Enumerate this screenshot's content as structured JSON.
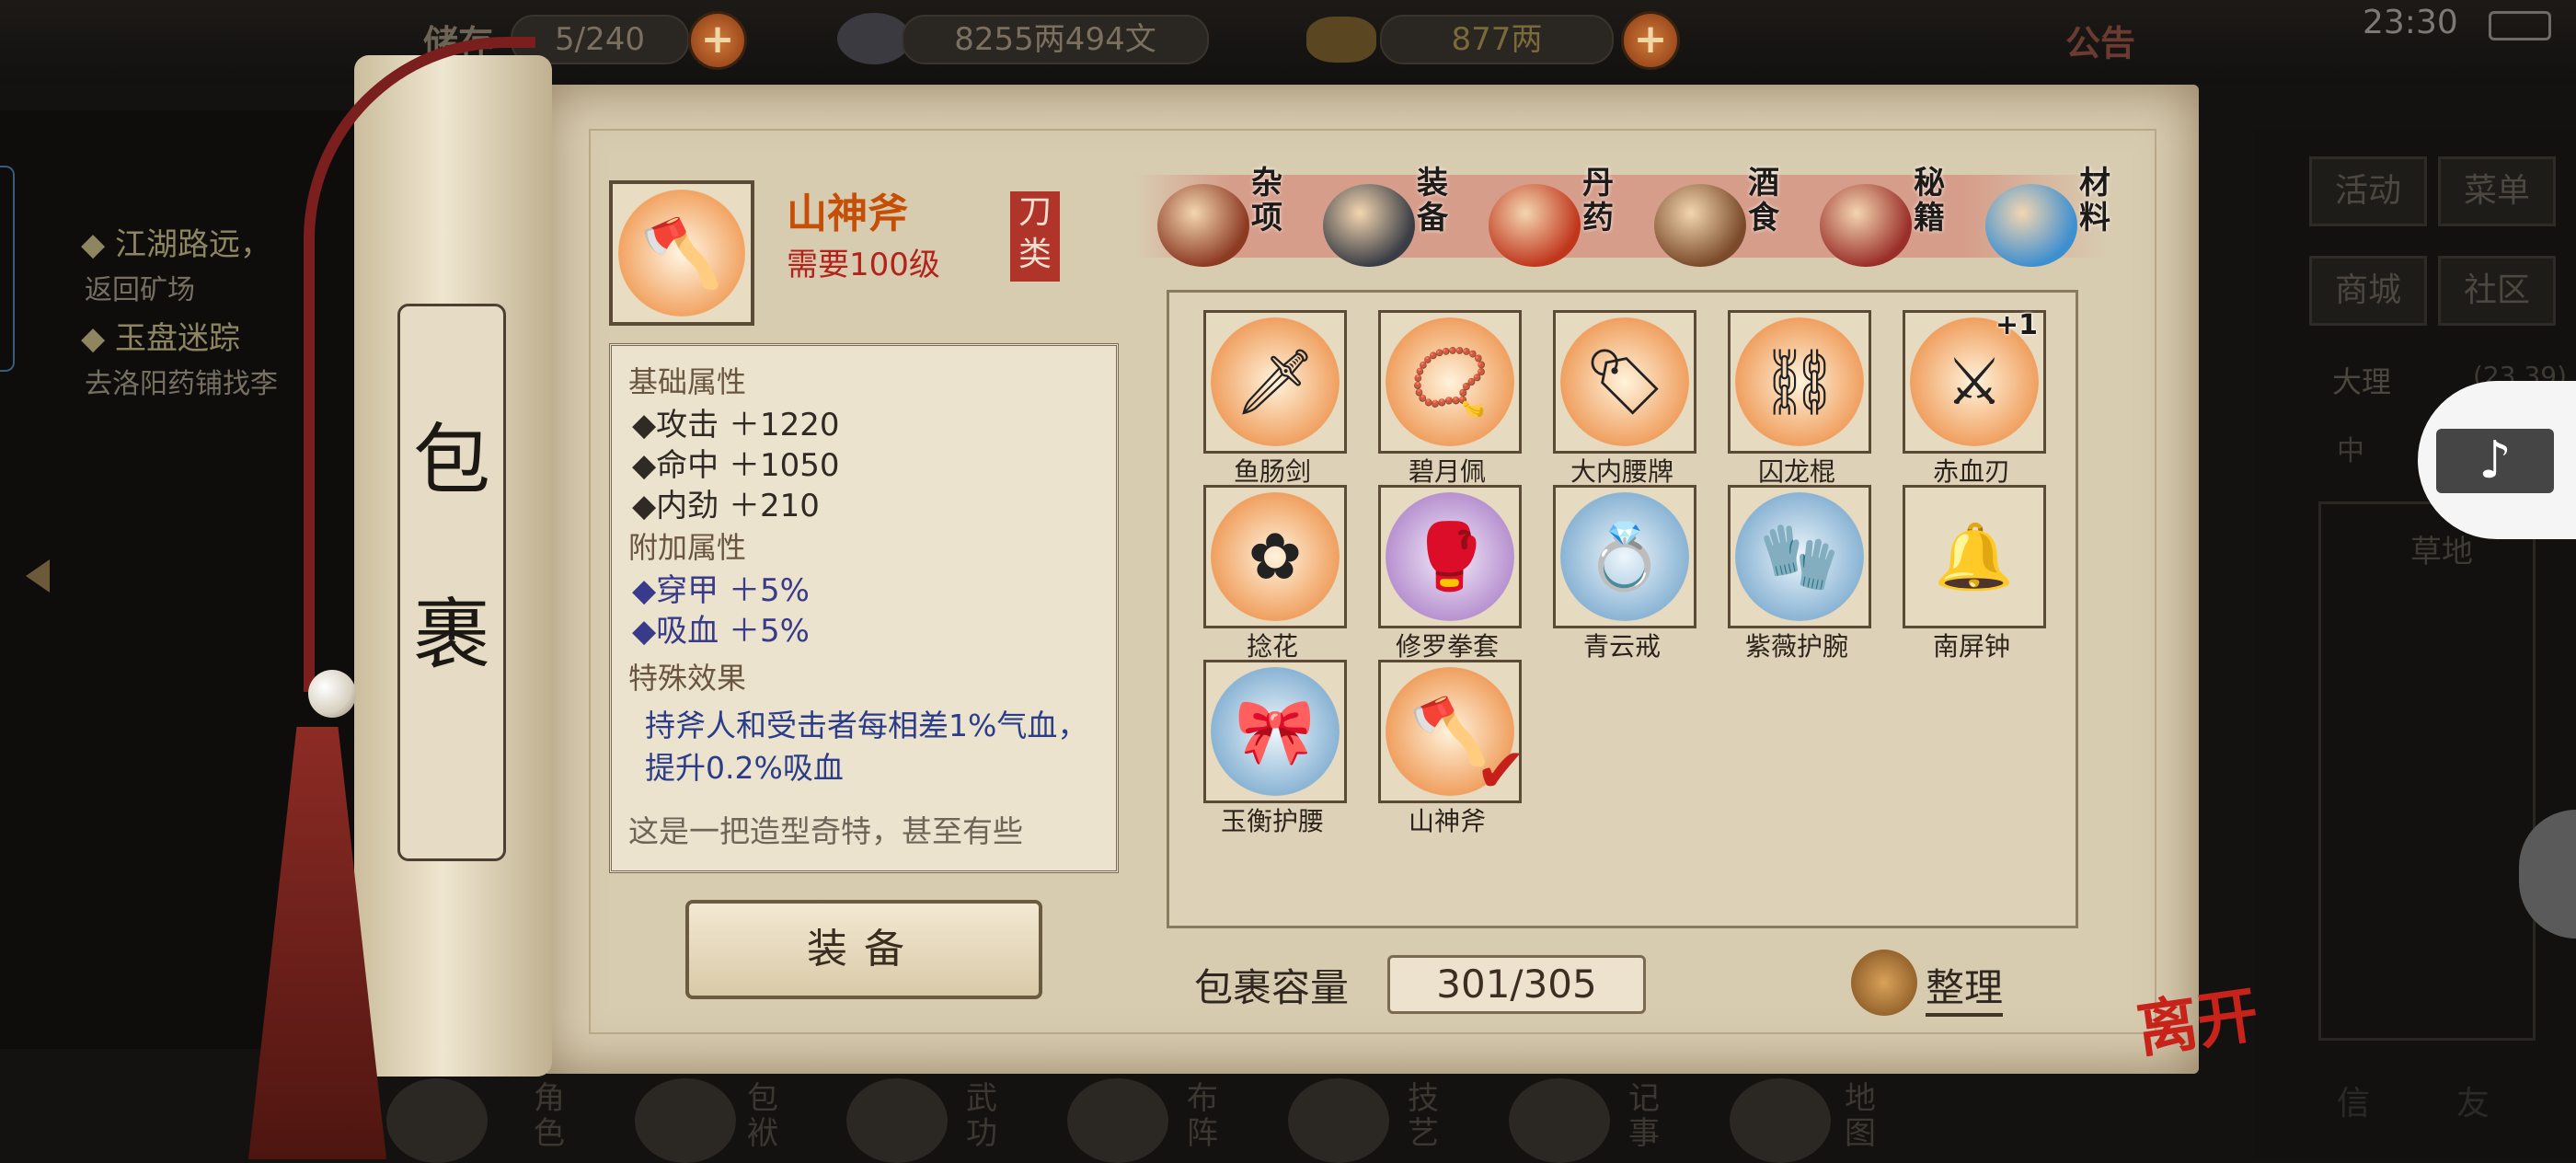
{
  "hud": {
    "bag_label": "储存",
    "bag_count": "5/240",
    "silver": "8255两494文",
    "gold": "877两",
    "plus": "+",
    "notice": "公告",
    "time": "23:30"
  },
  "quests": [
    {
      "title": "◆ 江湖路远，",
      "sub": "返回矿场"
    },
    {
      "title": "◆ 玉盘迷踪",
      "sub": "去洛阳药铺找李"
    }
  ],
  "right_panel": {
    "buttons": [
      "活动",
      "菜单",
      "商城",
      "社区"
    ],
    "location": "大理",
    "coords": "(23,39)",
    "channel": "中",
    "area": "草地",
    "bottom": [
      "信",
      "友"
    ]
  },
  "scroll_title": [
    "包",
    "裹"
  ],
  "selected": {
    "name": "山神斧",
    "requirement": "需要100级",
    "type": "刀类",
    "stats": {
      "base_header": "基础属性",
      "base": [
        "◆攻击 ＋1220",
        "◆命中 ＋1050",
        "◆内劲 ＋210"
      ],
      "extra_header": "附加属性",
      "extra": [
        "◆穿甲 ＋5%",
        "◆吸血 ＋5%"
      ],
      "special_header": "特殊效果",
      "special": "持斧人和受击者每相差1%气血，提升0.2%吸血",
      "description": "这是一把造型奇特，甚至有些"
    },
    "equip_button": "装备"
  },
  "tabs": [
    {
      "label": "杂项",
      "icon": "jar-icon",
      "color": "#8c3a22"
    },
    {
      "label": "装备",
      "icon": "armor-icon",
      "color": "#3a3d45",
      "active": true
    },
    {
      "label": "丹药",
      "icon": "pill-icon",
      "color": "#c0361c"
    },
    {
      "label": "酒食",
      "icon": "food-icon",
      "color": "#7a4a2a"
    },
    {
      "label": "秘籍",
      "icon": "book-icon",
      "color": "#9a2f2a"
    },
    {
      "label": "材料",
      "icon": "crystal-icon",
      "color": "#3d8fd0"
    }
  ],
  "items": [
    {
      "name": "鱼肠剑",
      "icon": "sword-icon",
      "glyph": "🗡",
      "glow": "orange"
    },
    {
      "name": "碧月佩",
      "icon": "pendant-icon",
      "glyph": "📿",
      "glow": "orange"
    },
    {
      "name": "大内腰牌",
      "icon": "token-icon",
      "glyph": "🏷",
      "glow": "orange"
    },
    {
      "name": "囚龙棍",
      "icon": "staff-icon",
      "glyph": "⛓",
      "glow": "orange"
    },
    {
      "name": "赤血刃",
      "icon": "blade-icon",
      "glyph": "⚔",
      "glow": "orange",
      "badge": "+1"
    },
    {
      "name": "捻花",
      "icon": "flower-icon",
      "glyph": "✿",
      "glow": "orange"
    },
    {
      "name": "修罗拳套",
      "icon": "gauntlet-icon",
      "glyph": "🥊",
      "glow": "purple"
    },
    {
      "name": "青云戒",
      "icon": "ring-icon",
      "glyph": "💍",
      "glow": "blue"
    },
    {
      "name": "紫薇护腕",
      "icon": "bracer-icon",
      "glyph": "🧤",
      "glow": "blue"
    },
    {
      "name": "南屏钟",
      "icon": "bell-icon",
      "glyph": "🔔",
      "glow": "none"
    },
    {
      "name": "玉衡护腰",
      "icon": "belt-icon",
      "glyph": "🎀",
      "glow": "blue"
    },
    {
      "name": "山神斧",
      "icon": "axe-icon",
      "glyph": "🪓",
      "glow": "orange",
      "equipped": true
    }
  ],
  "footer": {
    "capacity_label": "包裹容量",
    "capacity": "301/305",
    "sort": "整理",
    "leave": "离开"
  },
  "bottom_nav": [
    "角色",
    "包袱",
    "武功",
    "布阵",
    "技艺",
    "记事",
    "地图"
  ],
  "colors": {
    "paper": "#d8ccb0",
    "accent_orange": "#c64f08",
    "requirement_red": "#b3231c",
    "stat_blue": "#2a3c8a"
  }
}
